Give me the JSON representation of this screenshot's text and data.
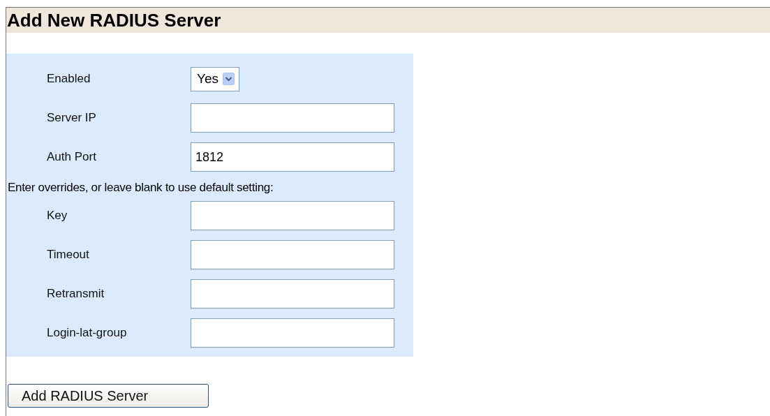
{
  "heading": "Add New RADIUS Server",
  "enabled": {
    "label": "Enabled",
    "value": "Yes"
  },
  "fields": [
    {
      "label": "Server IP"
    },
    {
      "label": "Auth Port",
      "value": "1812"
    }
  ],
  "note": "Enter overrides, or leave blank to use default setting:",
  "overrides": [
    {
      "label": "Key"
    },
    {
      "label": "Timeout"
    },
    {
      "label": "Retransmit"
    },
    {
      "label": "Login-lat-group"
    }
  ],
  "button": "Add RADIUS Server"
}
